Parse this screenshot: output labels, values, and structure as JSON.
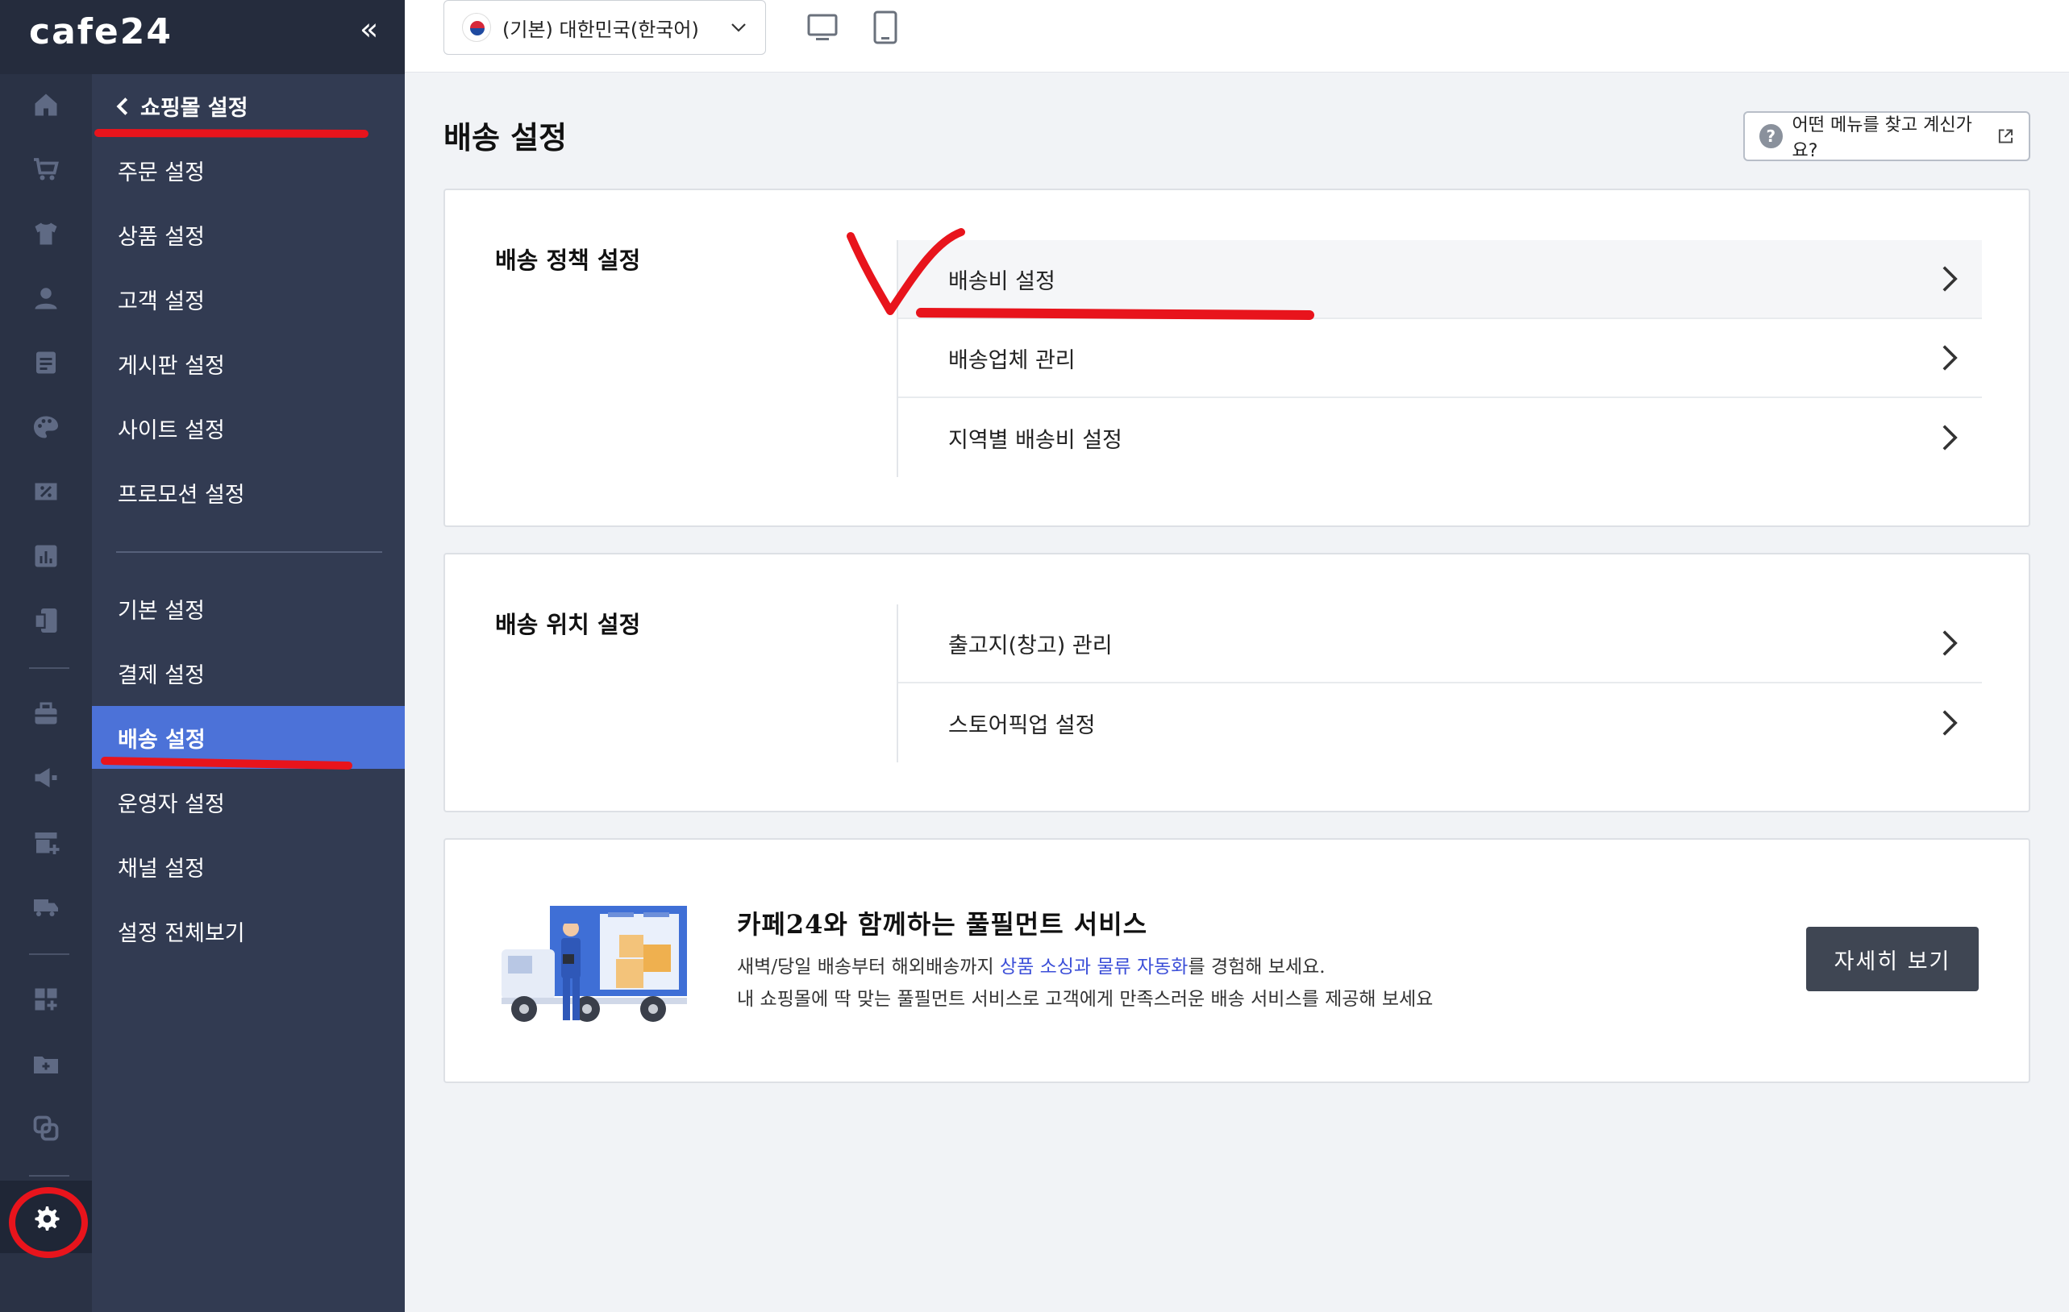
{
  "brand": {
    "logo": "cafe24",
    "collapse_icon": "«"
  },
  "rail": {
    "icons": [
      "home-icon",
      "cart-icon",
      "shirt-icon",
      "person-icon",
      "board-icon",
      "palette-icon",
      "promotion-icon",
      "stats-icon",
      "mobile-icon",
      "shop-icon",
      "megaphone-icon",
      "store-add-icon",
      "truck-icon",
      "apps-icon",
      "folder-add-icon",
      "copy-icon",
      "gear-icon"
    ]
  },
  "sidebar": {
    "back_label": "쇼핑몰 설정",
    "group1": [
      "주문 설정",
      "상품 설정",
      "고객 설정",
      "게시판 설정",
      "사이트 설정",
      "프로모션 설정"
    ],
    "group2": [
      "기본 설정",
      "결제 설정",
      "배송 설정",
      "운영자 설정",
      "채널 설정",
      "설정 전체보기"
    ],
    "active": "배송 설정"
  },
  "topbar": {
    "language": "(기본) 대한민국(한국어)"
  },
  "page": {
    "title": "배송 설정",
    "help": "어떤 메뉴를 찾고 계신가요?"
  },
  "policy": {
    "title": "배송 정책 설정",
    "items": [
      "배송비 설정",
      "배송업체 관리",
      "지역별 배송비 설정"
    ]
  },
  "location": {
    "title": "배송 위치 설정",
    "items": [
      "출고지(창고) 관리",
      "스토어픽업 설정"
    ]
  },
  "promo": {
    "title": "카페24와 함께하는 풀필먼트 서비스",
    "line1_pre": "새벽/당일 배송부터 해외배송까지 ",
    "line1_hl": "상품 소싱과 물류 자동화",
    "line1_post": "를 경험해 보세요.",
    "line2": "내 쇼핑몰에 딱 맞는 풀필먼트 서비스로 고객에게 만족스러운 배송 서비스를 제공해 보세요",
    "button": "자세히 보기"
  },
  "colors": {
    "rail_bg": "#2a3245",
    "sidebar_bg": "#323b52",
    "active_bg": "#4c72d8",
    "highlight": "#3c4fd8",
    "annotation": "#e8141c"
  }
}
